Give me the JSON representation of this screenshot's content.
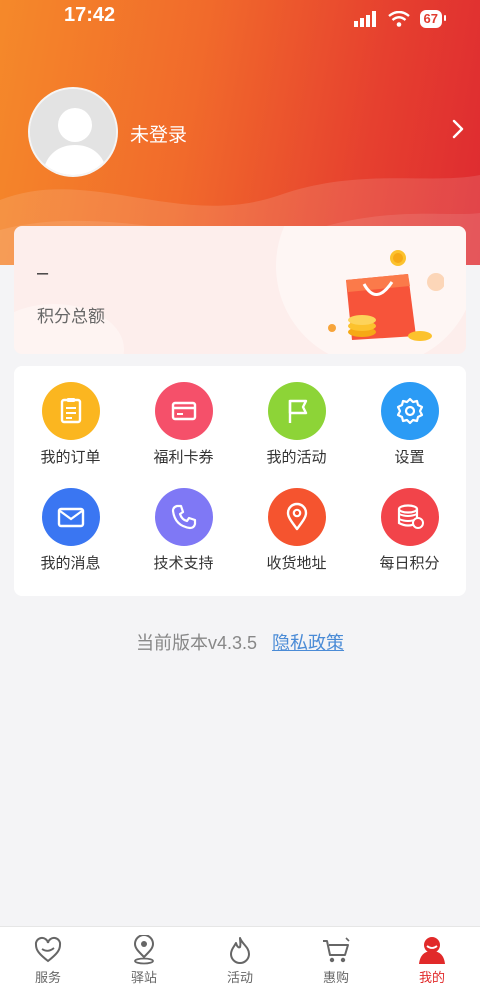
{
  "status": {
    "time": "17:42",
    "battery": "67"
  },
  "profile": {
    "login_text": "未登录"
  },
  "points": {
    "value": "–",
    "label": "积分总额"
  },
  "menu": [
    {
      "label": "我的订单",
      "icon": "order-icon",
      "color": "#fbb620"
    },
    {
      "label": "福利卡券",
      "icon": "coupon-icon",
      "color": "#f5506a"
    },
    {
      "label": "我的活动",
      "icon": "flag-icon",
      "color": "#8dd437"
    },
    {
      "label": "设置",
      "icon": "settings-gear-icon",
      "color": "#2b9bf5"
    },
    {
      "label": "我的消息",
      "icon": "message-icon",
      "color": "#3a76f2"
    },
    {
      "label": "技术支持",
      "icon": "phone-icon",
      "color": "#7f78f5"
    },
    {
      "label": "收货地址",
      "icon": "location-pin-icon",
      "color": "#f5542f"
    },
    {
      "label": "每日积分",
      "icon": "coins-icon",
      "color": "#f2444a"
    }
  ],
  "footer": {
    "version": "当前版本v4.3.5",
    "privacy": "隐私政策"
  },
  "tabs": [
    {
      "label": "服务",
      "icon": "heart-icon",
      "active": false
    },
    {
      "label": "驿站",
      "icon": "map-pin-icon",
      "active": false
    },
    {
      "label": "活动",
      "icon": "flame-icon",
      "active": false
    },
    {
      "label": "惠购",
      "icon": "cart-icon",
      "active": false
    },
    {
      "label": "我的",
      "icon": "profile-icon",
      "active": true
    }
  ],
  "colors": {
    "accent": "#e12a2a",
    "header_start": "#f5892a",
    "header_end": "#de2a30"
  }
}
